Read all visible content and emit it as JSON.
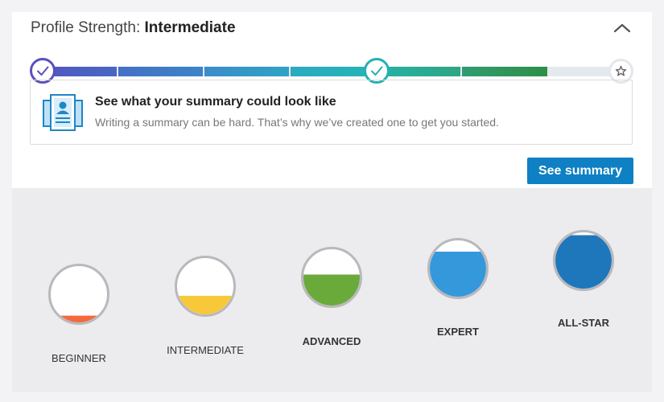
{
  "profile_strength": {
    "prefix": "Profile Strength:",
    "level": "Intermediate"
  },
  "icons": {
    "collapse": "chevron-up-icon",
    "step_done": "check-icon",
    "step_final": "star-icon",
    "summary": "profile-document-icon"
  },
  "colors": {
    "accent_button": "#0e80c3",
    "progress_gradient": [
      "#5256c0",
      "#3a8fcc",
      "#25b3b8",
      "#34a67a",
      "#2e8f45"
    ],
    "track": "#e4e9ee"
  },
  "summary_prompt": {
    "title": "See what your summary could look like",
    "subtitle": "Writing a summary can be hard. That’s why we’ve created one to get you started.",
    "button_label": "See summary"
  },
  "levels": [
    {
      "label": "BEGINNER",
      "fill_fraction": 0.12,
      "fill_color": "#f26a3d"
    },
    {
      "label": "INTERMEDIATE",
      "fill_fraction": 0.33,
      "fill_color": "#f7c93a"
    },
    {
      "label": "ADVANCED",
      "fill_fraction": 0.55,
      "fill_color": "#6aaa3a"
    },
    {
      "label": "EXPERT",
      "fill_fraction": 0.8,
      "fill_color": "#3498db"
    },
    {
      "label": "ALL-STAR",
      "fill_fraction": 0.95,
      "fill_color": "#1f77bb"
    }
  ]
}
